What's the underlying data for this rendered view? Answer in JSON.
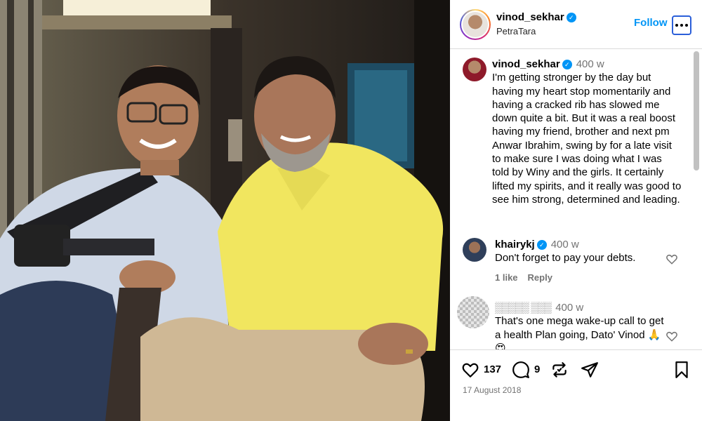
{
  "post": {
    "username": "vinod_sekhar",
    "location": "PetraTara",
    "follow_label": "Follow",
    "caption_time": "400 w",
    "caption": "I'm getting stronger by the day but having my heart stop momentarily and having a cracked rib has slowed me down quite a bit. But it was a real boost having my friend, brother and next pm Anwar Ibrahim, swing by for a late visit to make sure I was doing what I was told by Winy and the girls. It certainly lifted my spirits, and it really was good to see him strong, determined and leading.",
    "likes": "137",
    "comments_count": "9",
    "date": "17 August 2018"
  },
  "comments": [
    {
      "username": "khairykj",
      "time": "400 w",
      "text": "Don't forget to pay your debts.",
      "likes_label": "1 like",
      "reply_label": "Reply"
    },
    {
      "username": "▒▒▒▒▒ ▒▒▒",
      "time": "400 w",
      "text": "That's one mega wake-up call to get a health Plan going, Dato' Vinod 🙏😍"
    }
  ],
  "icons": {
    "verified": "verified-badge-icon",
    "more": "more-options-icon",
    "heart": "heart-icon",
    "comment": "comment-icon",
    "repost": "repost-icon",
    "share": "share-icon",
    "save": "bookmark-icon"
  },
  "colors": {
    "accent": "#0095f6",
    "muted": "#737373"
  }
}
